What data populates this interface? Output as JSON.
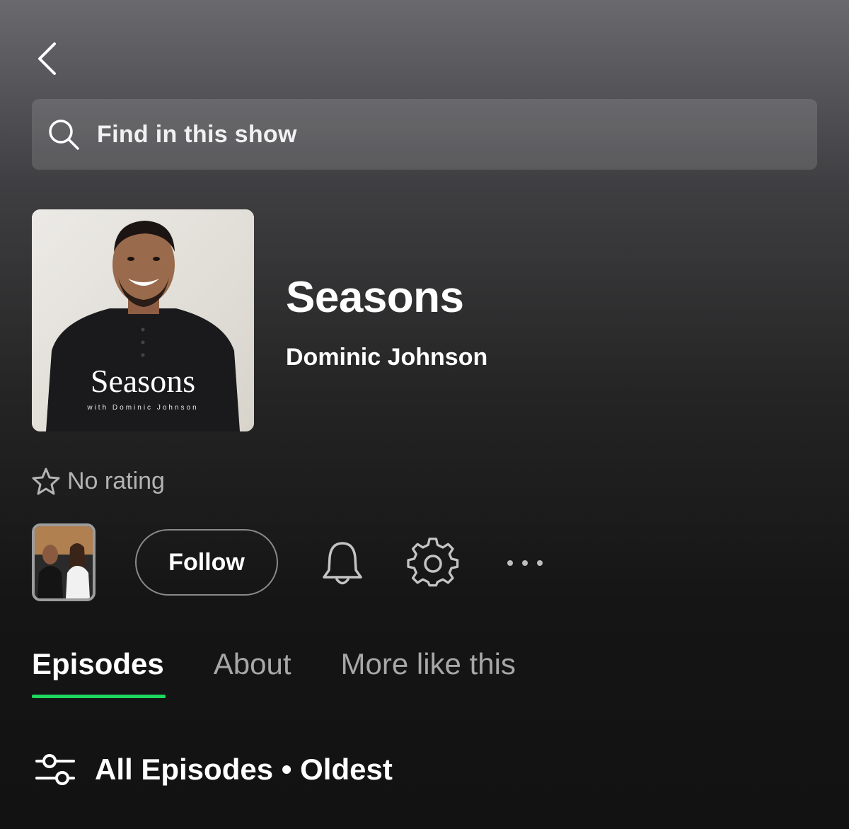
{
  "search": {
    "placeholder": "Find in this show"
  },
  "show": {
    "title": "Seasons",
    "author": "Dominic Johnson",
    "cover_title": "Seasons",
    "cover_subtitle": "with Dominic Johnson"
  },
  "rating": {
    "label": "No rating"
  },
  "actions": {
    "follow_label": "Follow"
  },
  "tabs": [
    {
      "label": "Episodes",
      "active": true
    },
    {
      "label": "About",
      "active": false
    },
    {
      "label": "More like this",
      "active": false
    }
  ],
  "filter": {
    "label": "All Episodes • Oldest"
  },
  "colors": {
    "accent": "#1ed760",
    "background": "#121212",
    "muted_text": "#a7a7a7"
  },
  "icons": [
    "chevron-left-icon",
    "search-icon",
    "star-icon",
    "bell-icon",
    "gear-icon",
    "more-icon",
    "filter-sliders-icon"
  ]
}
